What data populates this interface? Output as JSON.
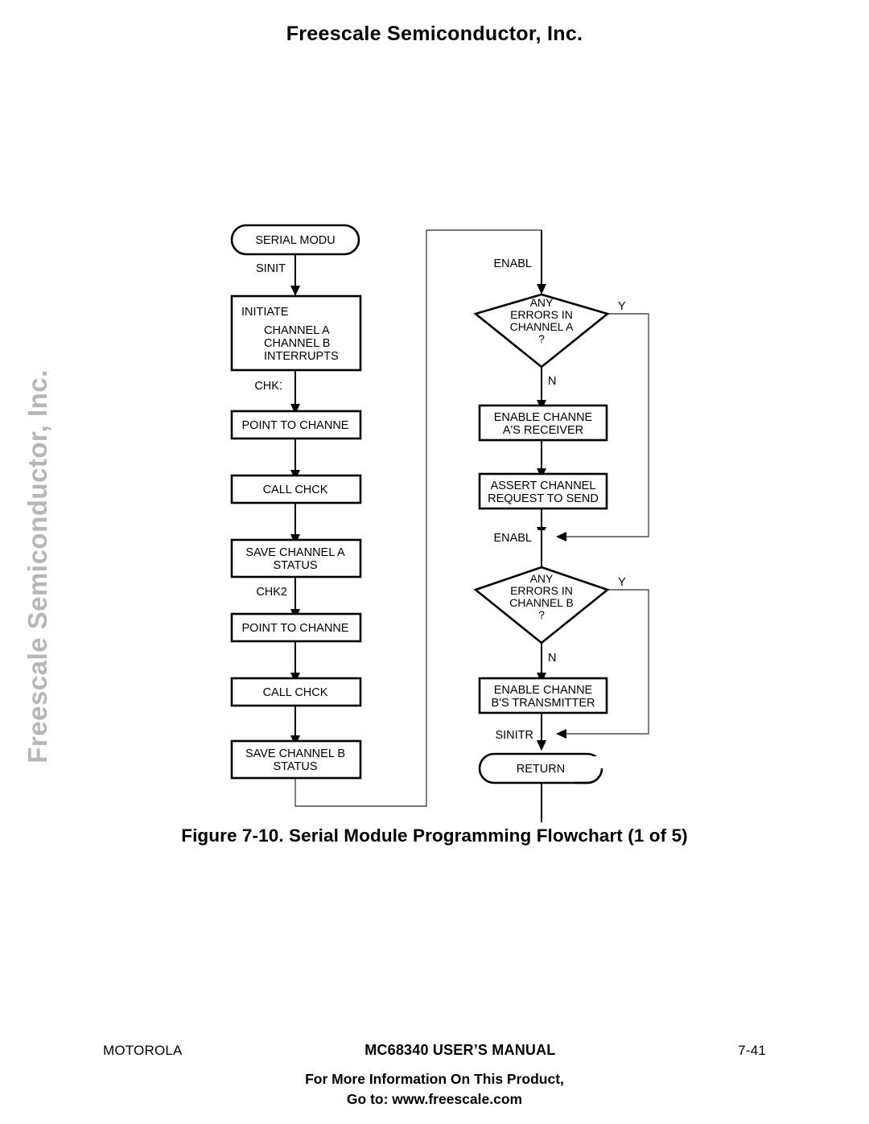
{
  "header": {
    "title": "Freescale Semiconductor, Inc."
  },
  "watermark": {
    "text": "Freescale Semiconductor, Inc."
  },
  "figure": {
    "caption": "Figure 7-10. Serial Module Programming Flowchart (1 of 5)"
  },
  "footer": {
    "left": "MOTOROLA",
    "center": "MC68340 USER’S MANUAL",
    "right": "7-41",
    "promo_line1": "For More Information On This Product,",
    "promo_line2": "Go to: www.freescale.com"
  },
  "flowchart": {
    "left_column": {
      "start_terminator": "SERIAL MODU",
      "label_sinit": "SINIT",
      "initiate_title": "INITIATE",
      "initiate_line1": "CHANNEL A",
      "initiate_line2": "CHANNEL B",
      "initiate_line3": "INTERRUPTS",
      "label_chk1": "CHK1",
      "point_a": "POINT TO CHANNE",
      "call_chk_a": "CALL CHCK",
      "save_a_line1": "SAVE CHANNEL A",
      "save_a_line2": "STATUS",
      "label_chk2": "CHK2",
      "point_b": "POINT TO CHANNE",
      "call_chk_b": "CALL CHCK",
      "save_b_line1": "SAVE CHANNEL B",
      "save_b_line2": "STATUS"
    },
    "right_column": {
      "label_enable_a": "ENABL",
      "decision_a_line1": "ANY",
      "decision_a_line2": "ERRORS IN",
      "decision_a_line3": "CHANNEL A",
      "decision_a_line4": "?",
      "decision_a_yes": "Y",
      "decision_a_no": "N",
      "enable_rx_line1": "ENABLE CHANNE",
      "enable_rx_line2": "A'S RECEIVER",
      "assert_rts_line1": "ASSERT CHANNEL",
      "assert_rts_line2": "REQUEST TO SEND",
      "label_enable_b": "ENABL",
      "decision_b_line1": "ANY",
      "decision_b_line2": "ERRORS IN",
      "decision_b_line3": "CHANNEL B",
      "decision_b_line4": "?",
      "decision_b_yes": "Y",
      "decision_b_no": "N",
      "enable_tx_line1": "ENABLE CHANNE",
      "enable_tx_line2": "B'S TRANSMITTER",
      "label_sinitr": "SINITR",
      "return_terminator": "RETURN"
    }
  }
}
